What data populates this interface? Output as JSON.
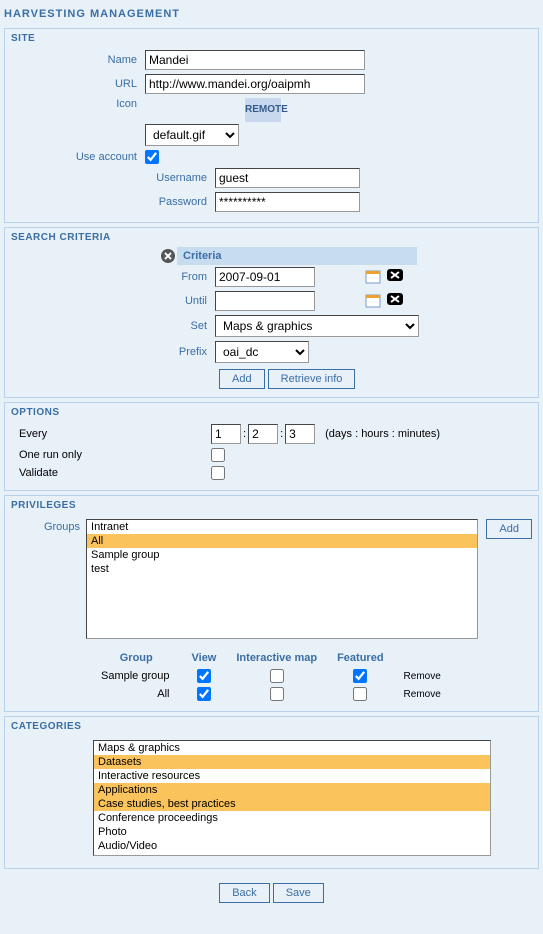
{
  "page_title": "HARVESTING MANAGEMENT",
  "sections": {
    "site": {
      "title": "SITE",
      "fields": {
        "name_label": "Name",
        "name_value": "Mandei",
        "url_label": "URL",
        "url_value": "http://www.mandei.org/oaipmh",
        "icon_label": "Icon",
        "icon_value": "default.gif",
        "icon_remote": "REMOTE",
        "use_account_label": "Use account",
        "use_account_checked": true,
        "username_label": "Username",
        "username_value": "guest",
        "password_label": "Password",
        "password_value": "**********"
      }
    },
    "search_criteria": {
      "title": "SEARCH CRITERIA",
      "criteria_header": "Criteria",
      "from_label": "From",
      "from_value": "2007-09-01",
      "until_label": "Until",
      "until_value": "",
      "set_label": "Set",
      "set_value": "Maps & graphics",
      "prefix_label": "Prefix",
      "prefix_value": "oai_dc",
      "add_btn": "Add",
      "retrieve_btn": "Retrieve info"
    },
    "options": {
      "title": "OPTIONS",
      "every_label": "Every",
      "every_days": "1",
      "every_hours": "2",
      "every_minutes": "3",
      "every_hint": "(days : hours : minutes)",
      "one_run_label": "One run only",
      "one_run_checked": false,
      "validate_label": "Validate",
      "validate_checked": false
    },
    "privileges": {
      "title": "PRIVILEGES",
      "groups_label": "Groups",
      "groups_list": [
        {
          "label": "Intranet",
          "selected": false
        },
        {
          "label": "All",
          "selected": true
        },
        {
          "label": "Sample group",
          "selected": false
        },
        {
          "label": "test",
          "selected": false
        }
      ],
      "add_btn": "Add",
      "table_headers": {
        "group": "Group",
        "view": "View",
        "inter": "Interactive map",
        "feat": "Featured"
      },
      "rows": [
        {
          "group": "Sample group",
          "view": true,
          "inter": false,
          "feat": true,
          "remove": "Remove"
        },
        {
          "group": "All",
          "view": true,
          "inter": false,
          "feat": false,
          "remove": "Remove"
        }
      ]
    },
    "categories": {
      "title": "CATEGORIES",
      "list": [
        {
          "label": "Maps & graphics",
          "selected": false
        },
        {
          "label": "Datasets",
          "selected": true
        },
        {
          "label": "Interactive resources",
          "selected": false
        },
        {
          "label": "Applications",
          "selected": true
        },
        {
          "label": "Case studies, best practices",
          "selected": true
        },
        {
          "label": "Conference proceedings",
          "selected": false
        },
        {
          "label": "Photo",
          "selected": false
        },
        {
          "label": "Audio/Video",
          "selected": false
        }
      ]
    }
  },
  "footer": {
    "back": "Back",
    "save": "Save"
  }
}
